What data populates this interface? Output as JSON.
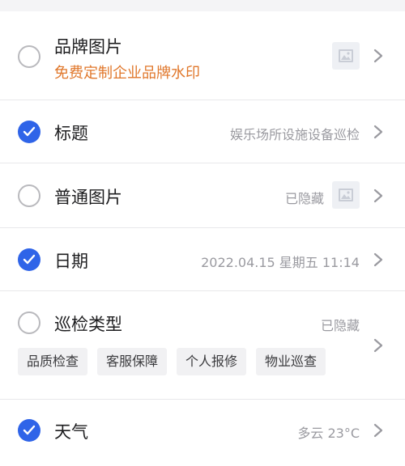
{
  "rows": [
    {
      "label": "品牌图片",
      "sublabel": "免费定制企业品牌水印",
      "checked": false,
      "thumb_icon": "image-icon"
    },
    {
      "label": "标题",
      "value": "娱乐场所设施设备巡检",
      "checked": true
    },
    {
      "label": "普通图片",
      "value": "已隐藏",
      "checked": false,
      "thumb_icon": "image-icon"
    },
    {
      "label": "日期",
      "value": "2022.04.15 星期五 11:14",
      "checked": true
    },
    {
      "label": "巡检类型",
      "value": "已隐藏",
      "checked": false,
      "tags": [
        "品质检查",
        "客服保障",
        "个人报修",
        "物业巡查"
      ]
    },
    {
      "label": "天气",
      "value": "多云 23°C",
      "checked": true
    }
  ],
  "colors": {
    "accent": "#2f64e8",
    "sublabel": "#e0772b",
    "muted": "#9a9aa0"
  }
}
